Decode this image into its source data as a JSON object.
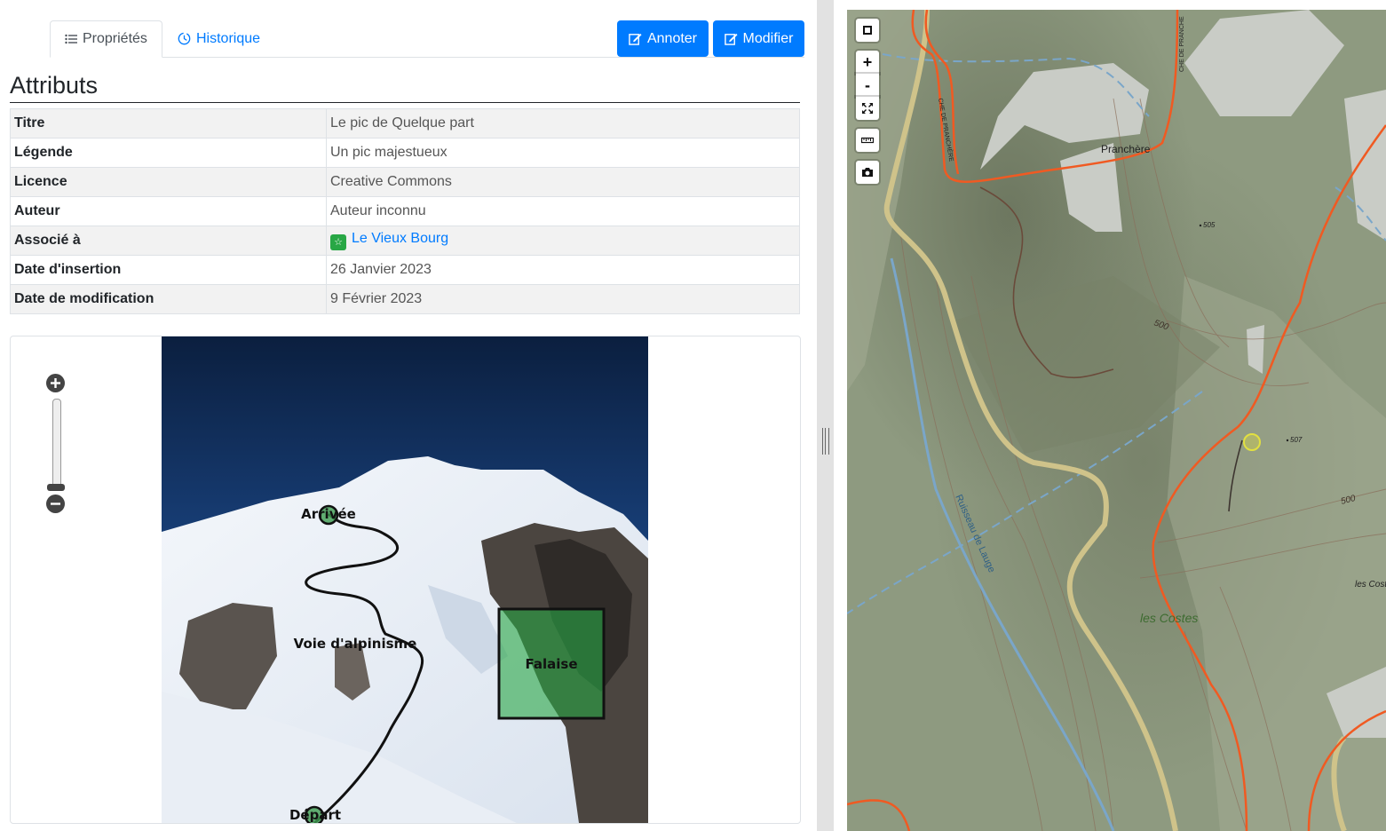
{
  "tabs": {
    "properties": "Propriétés",
    "history": "Historique"
  },
  "actions": {
    "annotate": "Annoter",
    "edit": "Modifier"
  },
  "attributes": {
    "heading": "Attributs",
    "rows": [
      {
        "key": "Titre",
        "value": "Le pic de Quelque part"
      },
      {
        "key": "Légende",
        "value": "Un pic majestueux"
      },
      {
        "key": "Licence",
        "value": "Creative Commons"
      },
      {
        "key": "Auteur",
        "value": "Auteur inconnu"
      },
      {
        "key": "Associé à",
        "value": "Le Vieux Bourg"
      },
      {
        "key": "Date d'insertion",
        "value": "26 Janvier 2023"
      },
      {
        "key": "Date de modification",
        "value": "9 Février 2023"
      }
    ]
  },
  "annotations": {
    "arrival": "Arrivée",
    "route": "Voie d'alpinisme",
    "cliff": "Falaise",
    "start": "Départ"
  },
  "map": {
    "controls": {
      "zoom_in": "+",
      "zoom_out": "-"
    },
    "labels": {
      "village": "Pranchère",
      "place": "les Costes",
      "place_edge": "les Cost",
      "stream": "Ruisseau de Lauge",
      "road_vertical": "CHE DE PRANCHE",
      "road_left": "CHE DE PRANCHÈRE",
      "contour_500a": "500",
      "contour_500b": "500",
      "spot_505": "505",
      "spot_507": "507"
    }
  },
  "colors": {
    "primary": "#007bff",
    "success": "#28a745",
    "map_bg": "#8a9579",
    "road": "#f05a22",
    "track": "#cfc38a",
    "stream": "#7aa6c9"
  }
}
